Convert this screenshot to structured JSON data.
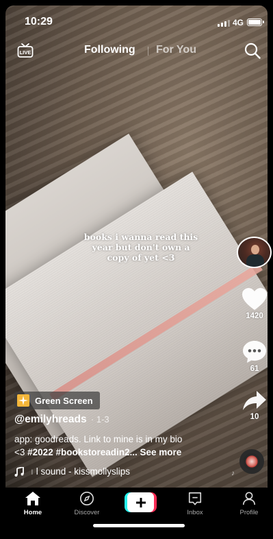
{
  "status_bar": {
    "time": "10:29",
    "network": "4G"
  },
  "top_nav": {
    "live_label": "LIVE",
    "tabs": [
      {
        "label": "Following",
        "active": true
      },
      {
        "label": "For You",
        "active": false
      }
    ]
  },
  "video": {
    "overlay_text": "books i wanna read this year but don't own a copy of yet <3"
  },
  "actions": {
    "likes": "1420",
    "comments": "61",
    "shares": "10"
  },
  "post": {
    "effect_label": "Green Screen",
    "username": "@emilyhreads",
    "date": "· 1-3",
    "caption_line1": "app: goodreads. Link to mine is in my bio",
    "caption_line2_prefix": "<3 ",
    "caption_hashtags": "#2022 #bookstoreadin2...",
    "see_more": "See more",
    "sound_prefix": "ı",
    "sound": "l sound - kissmollyslips"
  },
  "bottom_nav": {
    "items": [
      {
        "label": "Home",
        "active": true
      },
      {
        "label": "Discover",
        "active": false
      },
      {
        "label": "Inbox",
        "active": false
      },
      {
        "label": "Profile",
        "active": false
      }
    ]
  },
  "colors": {
    "accent_cyan": "#25f4ee",
    "accent_red": "#fe2c55",
    "effect_icon": "#f4b63a"
  }
}
